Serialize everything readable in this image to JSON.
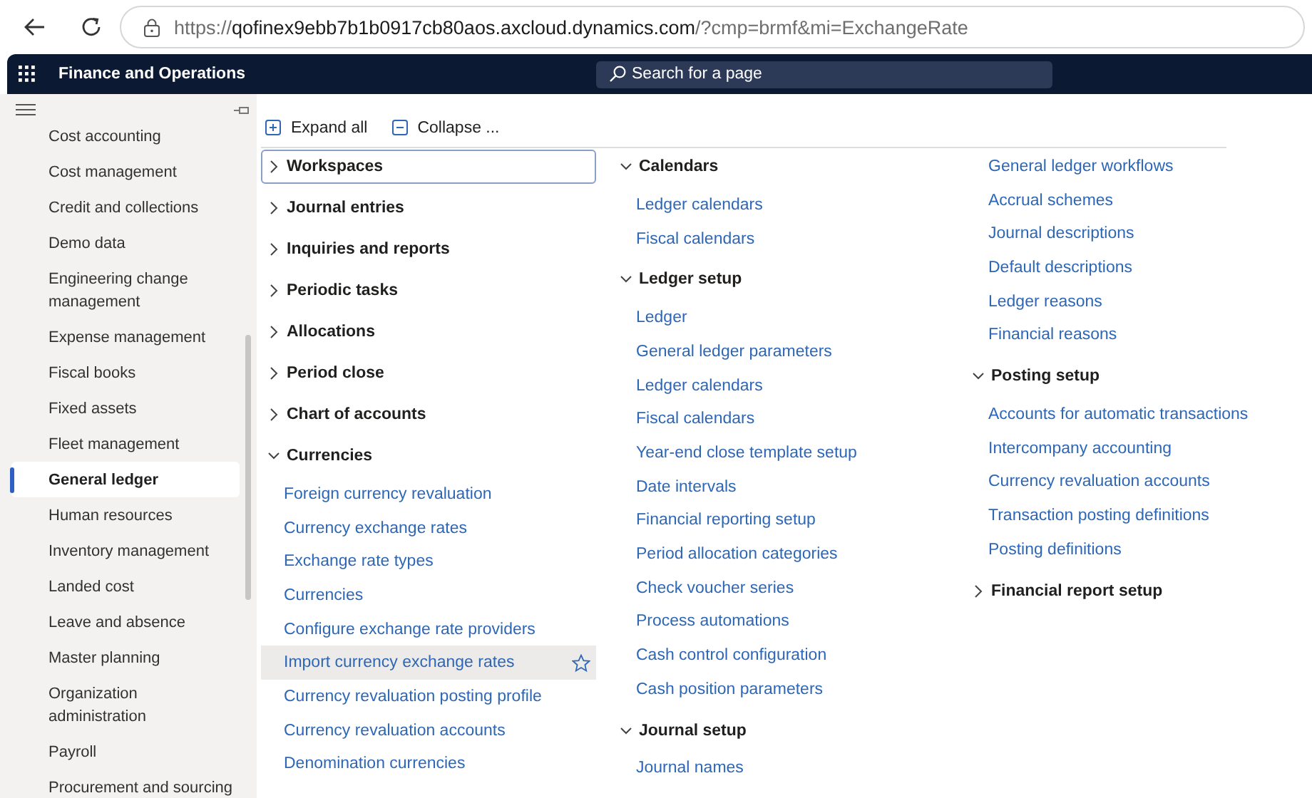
{
  "browser": {
    "url_scheme": "https://",
    "url_host": "qofinex9ebb7b1b0917cb80aos.axcloud.dynamics.com",
    "url_path": "/?cmp=brmf&mi=ExchangeRate"
  },
  "app_bar": {
    "title": "Finance and Operations",
    "search": {
      "placeholder": "Search for a page"
    }
  },
  "sidebar": {
    "items": [
      {
        "label": "Cost accounting",
        "selected": false
      },
      {
        "label": "Cost management",
        "selected": false
      },
      {
        "label": "Credit and collections",
        "selected": false
      },
      {
        "label": "Demo data",
        "selected": false
      },
      {
        "label": "Engineering change management",
        "selected": false
      },
      {
        "label": "Expense management",
        "selected": false
      },
      {
        "label": "Fiscal books",
        "selected": false
      },
      {
        "label": "Fixed assets",
        "selected": false
      },
      {
        "label": "Fleet management",
        "selected": false
      },
      {
        "label": "General ledger",
        "selected": true
      },
      {
        "label": "Human resources",
        "selected": false
      },
      {
        "label": "Inventory management",
        "selected": false
      },
      {
        "label": "Landed cost",
        "selected": false
      },
      {
        "label": "Leave and absence",
        "selected": false
      },
      {
        "label": "Master planning",
        "selected": false
      },
      {
        "label": "Organization administration",
        "selected": false
      },
      {
        "label": "Payroll",
        "selected": false
      },
      {
        "label": "Procurement and sourcing",
        "selected": false
      }
    ]
  },
  "toolbar": {
    "buttons": [
      {
        "label": "Expand all",
        "kind": "expand"
      },
      {
        "label": "Collapse ...",
        "kind": "collapse"
      }
    ]
  },
  "columns": [
    {
      "groups": [
        {
          "title": "Workspaces",
          "expanded": false,
          "focused": true
        },
        {
          "title": "Journal entries",
          "expanded": false,
          "focused": false
        },
        {
          "title": "Inquiries and reports",
          "expanded": false,
          "focused": false
        },
        {
          "title": "Periodic tasks",
          "expanded": false,
          "focused": false
        },
        {
          "title": "Allocations",
          "expanded": false,
          "focused": false
        },
        {
          "title": "Period close",
          "expanded": false,
          "focused": false
        },
        {
          "title": "Chart of accounts",
          "expanded": false,
          "focused": false
        },
        {
          "title": "Currencies",
          "expanded": true,
          "focused": false,
          "links": [
            {
              "label": "Foreign currency revaluation",
              "highlighted": false
            },
            {
              "label": "Currency exchange rates",
              "highlighted": false
            },
            {
              "label": "Exchange rate types",
              "highlighted": false
            },
            {
              "label": "Currencies",
              "highlighted": false
            },
            {
              "label": "Configure exchange rate providers",
              "highlighted": false
            },
            {
              "label": "Import currency exchange rates",
              "highlighted": true
            },
            {
              "label": "Currency revaluation posting profile",
              "highlighted": false
            },
            {
              "label": "Currency revaluation accounts",
              "highlighted": false
            },
            {
              "label": "Denomination currencies",
              "highlighted": false
            }
          ]
        }
      ]
    },
    {
      "groups": [
        {
          "title": "Calendars",
          "expanded": true,
          "focused": false,
          "links": [
            {
              "label": "Ledger calendars",
              "highlighted": false
            },
            {
              "label": "Fiscal calendars",
              "highlighted": false
            }
          ]
        },
        {
          "title": "Ledger setup",
          "expanded": true,
          "focused": false,
          "links": [
            {
              "label": "Ledger",
              "highlighted": false
            },
            {
              "label": "General ledger parameters",
              "highlighted": false
            },
            {
              "label": "Ledger calendars",
              "highlighted": false
            },
            {
              "label": "Fiscal calendars",
              "highlighted": false
            },
            {
              "label": "Year-end close template setup",
              "highlighted": false
            },
            {
              "label": "Date intervals",
              "highlighted": false
            },
            {
              "label": "Financial reporting setup",
              "highlighted": false
            },
            {
              "label": "Period allocation categories",
              "highlighted": false
            },
            {
              "label": "Check voucher series",
              "highlighted": false
            },
            {
              "label": "Process automations",
              "highlighted": false
            },
            {
              "label": "Cash control configuration",
              "highlighted": false
            },
            {
              "label": "Cash position parameters",
              "highlighted": false
            }
          ]
        },
        {
          "title": "Journal setup",
          "expanded": true,
          "focused": false,
          "links": [
            {
              "label": "Journal names",
              "highlighted": false
            }
          ]
        }
      ]
    },
    {
      "groups": [
        {
          "links": [
            {
              "label": "General ledger workflows",
              "highlighted": false
            },
            {
              "label": "Accrual schemes",
              "highlighted": false
            },
            {
              "label": "Journal descriptions",
              "highlighted": false
            },
            {
              "label": "Default descriptions",
              "highlighted": false
            },
            {
              "label": "Ledger reasons",
              "highlighted": false
            },
            {
              "label": "Financial reasons",
              "highlighted": false
            }
          ]
        },
        {
          "title": "Posting setup",
          "expanded": true,
          "focused": false,
          "links": [
            {
              "label": "Accounts for automatic transactions",
              "highlighted": false
            },
            {
              "label": "Intercompany accounting",
              "highlighted": false
            },
            {
              "label": "Currency revaluation accounts",
              "highlighted": false
            },
            {
              "label": "Transaction posting definitions",
              "highlighted": false
            },
            {
              "label": "Posting definitions",
              "highlighted": false
            }
          ]
        },
        {
          "title": "Financial report setup",
          "expanded": false,
          "focused": false
        }
      ]
    }
  ]
}
